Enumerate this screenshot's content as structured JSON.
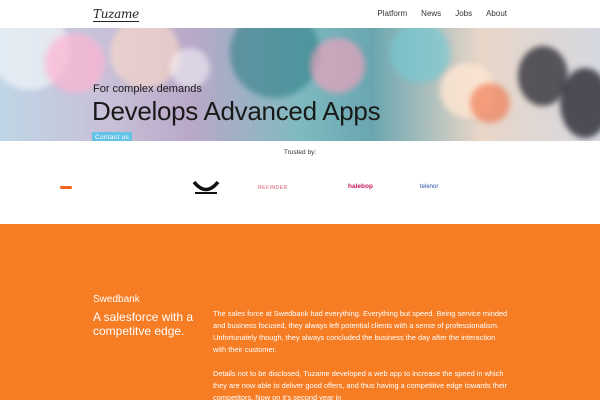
{
  "nav": {
    "logo": "Tuzame",
    "links": [
      "Platform",
      "News",
      "Jobs",
      "About"
    ]
  },
  "hero": {
    "subtitle": "For complex demands",
    "title": "Develops Advanced Apps",
    "cta": "Contact us"
  },
  "trusted": {
    "label": "Trusted by:",
    "logos": [
      "",
      "",
      "REFINDER",
      "halebop",
      "telenor"
    ]
  },
  "case": {
    "client": "Swedbank",
    "headline": "A salesforce with a competitve edge.",
    "paragraphs": [
      "The sales force at Swedbank had everything. Everything but speed. Being service minded and business focused, they always left potential clients with a sense of professionalism. Unfortunately though, they always concluded the business the day after the interaction with their customer.",
      "Details not to be disclosed, Tuzame developed a web app to increase the speed in which they are now able to deliver good offers, and thus having a competitive edge towards their competitors. Now on it's second year in"
    ]
  },
  "colors": {
    "accent_orange": "#f77d24",
    "cta_blue": "#63c2e6"
  }
}
